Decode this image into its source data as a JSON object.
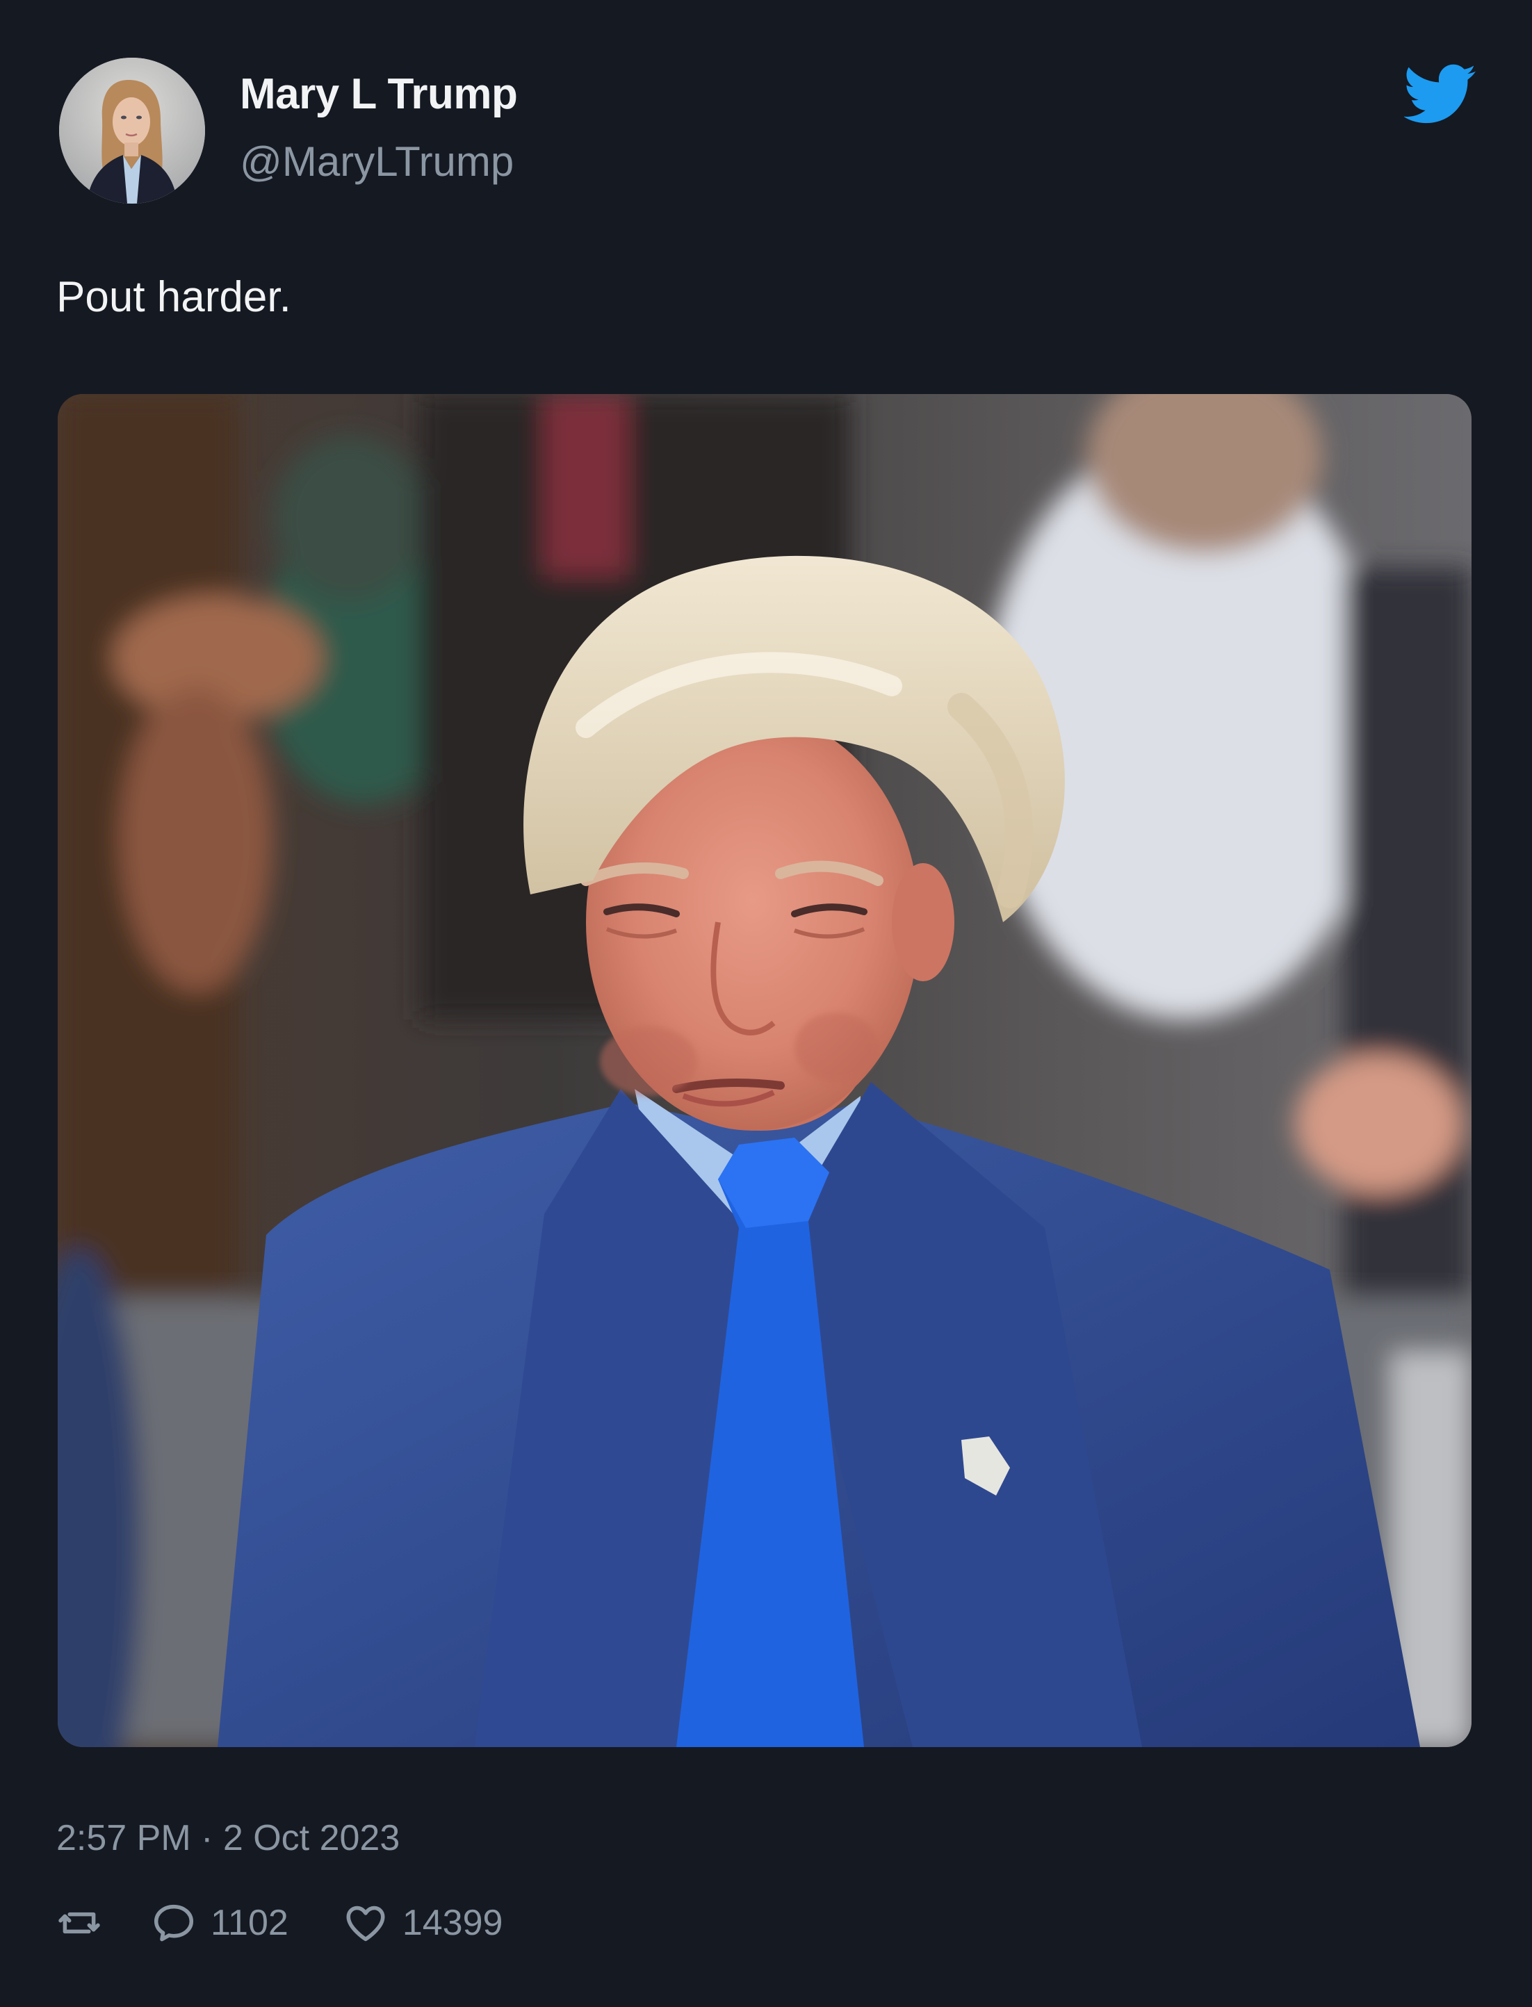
{
  "tweet": {
    "author": {
      "name": "Mary L Trump",
      "handle": "@MaryLTrump",
      "avatar_icon": "profile-photo"
    },
    "text": "Pout harder.",
    "media": {
      "type": "photo",
      "icon": "photo"
    },
    "timestamp": "2:57 PM · 2 Oct 2023",
    "stats": {
      "replies": "1102",
      "likes": "14399"
    }
  },
  "icons": {
    "brand": "twitter-bird-icon",
    "retweet": "retweet-icon",
    "reply": "reply-icon",
    "like": "heart-icon"
  },
  "colors": {
    "background": "#151922",
    "text_primary": "#f2f3f4",
    "text_secondary": "#8b96a3",
    "twitter_blue": "#1d9bf0"
  }
}
